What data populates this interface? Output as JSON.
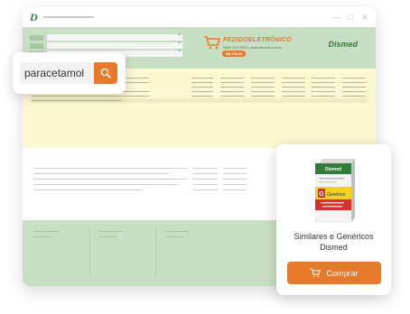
{
  "window": {
    "logo_letter": "D",
    "controls": [
      "—",
      "□",
      "✕"
    ]
  },
  "header": {
    "brand_title": "PEDIDOELETRÔNICO",
    "brand_sub": "0800 702 0503 | www.dismed.com.br",
    "brand_pill": "R$ 200,00",
    "dismed_logo": "Dismed"
  },
  "search": {
    "value": "paracetamol",
    "icon": "search-icon"
  },
  "product": {
    "name_line1": "Similares e Genéricos",
    "name_line2": "Dismed",
    "buy_label": "Comprar",
    "box_brand": "Dismed",
    "box_label": "Genérico"
  },
  "colors": {
    "accent": "#e8792b",
    "brand_green": "#2e7d3a",
    "header_green": "#c9dfc4",
    "yellow_area": "#fbf8d2"
  }
}
